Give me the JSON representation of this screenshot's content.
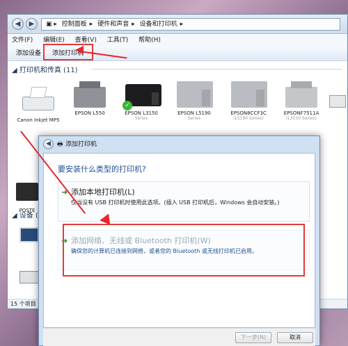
{
  "explorer": {
    "breadcrumb": [
      "控制面板",
      "硬件和声音",
      "设备和打印机"
    ],
    "menu": [
      "文件(F)",
      "编辑(E)",
      "查看(V)",
      "工具(T)",
      "帮助(H)"
    ],
    "toolbar": {
      "add_device": "添加设备",
      "add_printer": "添加打印机"
    },
    "printers_section": "打印机和传真 (11)",
    "devices_section": "设备 (4)",
    "devices": [
      {
        "name": "Canon Inkjet MP5",
        "sub": ""
      },
      {
        "name": "EPSON L550",
        "sub": ""
      },
      {
        "name": "EPSON L3150",
        "sub": "Series"
      },
      {
        "name": "EPSON L5190",
        "sub": "Series"
      },
      {
        "name": "EPSON8CCF3C",
        "sub": "(L5190 Series)"
      },
      {
        "name": "EPSONF7511A",
        "sub": "(L3150 Series)"
      }
    ],
    "poster_label": "POSTE",
    "status": "15 个项目"
  },
  "dialog": {
    "title": "添加打印机",
    "heading": "要安装什么类型的打印机?",
    "options": [
      {
        "title": "添加本地打印机(L)",
        "desc": "仅当没有 USB 打印机时使用此选项。(插入 USB 打印机后，Windows 会自动安装。)"
      },
      {
        "title": "添加网络、无线或 Bluetooth 打印机(W)",
        "desc": "确保您的计算机已连接到网络，或者您的 Bluetooth 或无线打印机已启用。"
      }
    ],
    "next_button": "下一步(N)",
    "cancel_button": "取消"
  },
  "colors": {
    "annotation_red": "#e5262f",
    "link_blue": "#1e4f96"
  }
}
